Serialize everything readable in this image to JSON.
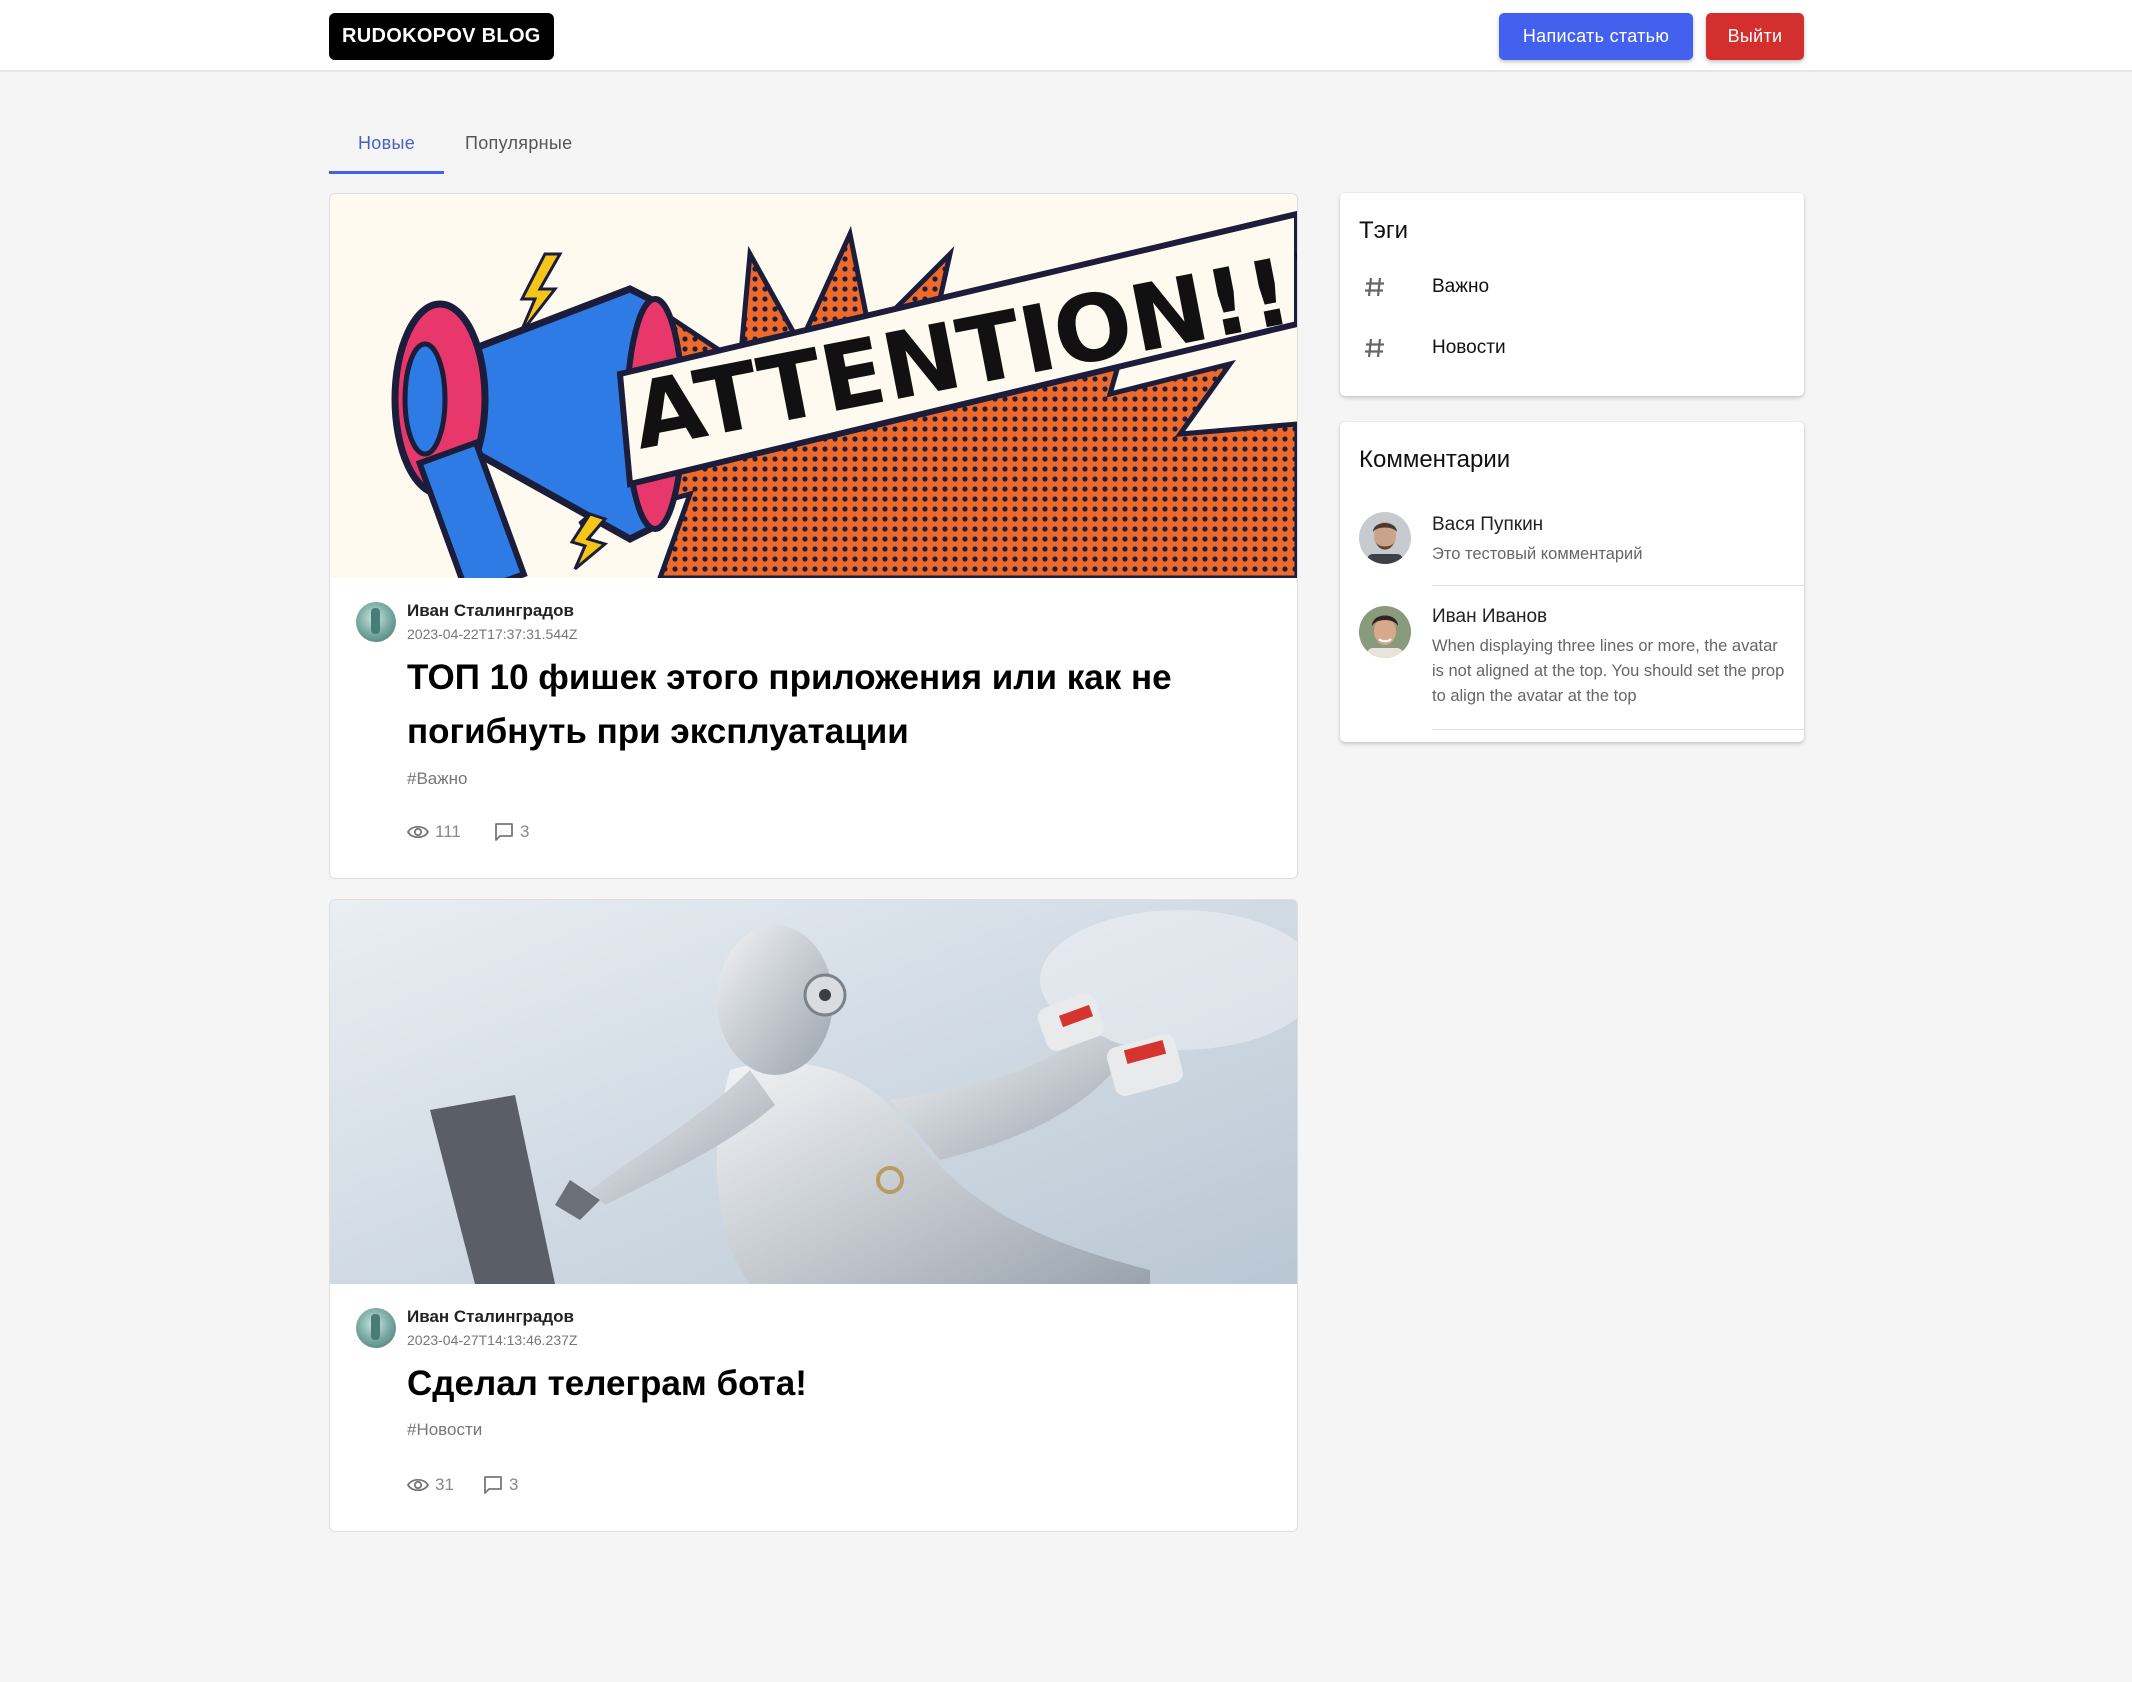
{
  "header": {
    "logo": "RUDOKOPOV BLOG",
    "write_button": "Написать статью",
    "exit_button": "Выйти"
  },
  "tabs": [
    {
      "label": "Новые",
      "active": true
    },
    {
      "label": "Популярные",
      "active": false
    }
  ],
  "posts": [
    {
      "cover_text": "ATTENTION!!!",
      "author": "Иван Сталинградов",
      "date": "2023-04-22T17:37:31.544Z",
      "title": "ТОП 10 фишек этого приложения или как не погибнуть при эксплуатации",
      "tag": "#Важно",
      "views": "111",
      "comments": "3"
    },
    {
      "author": "Иван Сталинградов",
      "date": "2023-04-27T14:13:46.237Z",
      "title": "Сделал телеграм бота!",
      "tag": "#Новости",
      "views": "31",
      "comments": "3"
    }
  ],
  "tags_panel": {
    "title": "Тэги",
    "items": [
      "Важно",
      "Новости"
    ]
  },
  "comments_panel": {
    "title": "Комментарии",
    "items": [
      {
        "name": "Вася Пупкин",
        "text": "Это тестовый комментарий"
      },
      {
        "name": "Иван Иванов",
        "text": "When displaying three lines or more, the avatar is not aligned at the top. You should set the prop to align the avatar at the top"
      }
    ]
  },
  "colors": {
    "primary": "#4361ee",
    "danger": "#d32f2f",
    "background": "#f5f5f5"
  },
  "icons": {
    "views": "eye-icon",
    "comments": "comment-icon",
    "tag": "hash-icon"
  }
}
